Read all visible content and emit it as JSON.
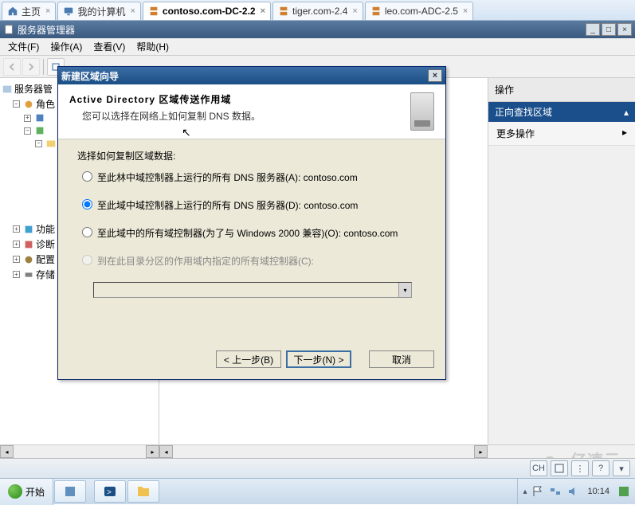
{
  "tabs": [
    {
      "label": "主页",
      "icon": "home"
    },
    {
      "label": "我的计算机",
      "icon": "monitor"
    },
    {
      "label": "contoso.com-DC-2.2",
      "icon": "server",
      "active": true
    },
    {
      "label": "tiger.com-2.4",
      "icon": "server"
    },
    {
      "label": "leo.com-ADC-2.5",
      "icon": "server"
    }
  ],
  "mmc": {
    "title": "服务器管理器",
    "menu": {
      "file": "文件(F)",
      "action": "操作(A)",
      "view": "查看(V)",
      "help": "帮助(H)"
    }
  },
  "tree": {
    "root": "服务器管",
    "roles": "角色",
    "features": "功能",
    "diagnostics": "诊断",
    "configuration": "配置",
    "storage": "存储"
  },
  "actions": {
    "header": "操作",
    "section": "正向查找区域",
    "more": "更多操作"
  },
  "dialog": {
    "title": "新建区域向导",
    "heading": "Active Directory 区域传送作用域",
    "sub": "您可以选择在网络上如何复制 DNS 数据。",
    "prompt": "选择如何复制区域数据:",
    "opt1": "至此林中域控制器上运行的所有 DNS 服务器(A): contoso.com",
    "opt2": "至此域中域控制器上运行的所有 DNS 服务器(D): contoso.com",
    "opt3": "至此域中的所有域控制器(为了与 Windows 2000 兼容)(O): contoso.com",
    "opt4": "到在此目录分区的作用域内指定的所有域控制器(C):",
    "back": "< 上一步(B)",
    "next": "下一步(N) >",
    "cancel": "取消"
  },
  "taskbar": {
    "start": "开始",
    "lang": "CH",
    "time": "10:14",
    "watermark": "亿速云"
  }
}
